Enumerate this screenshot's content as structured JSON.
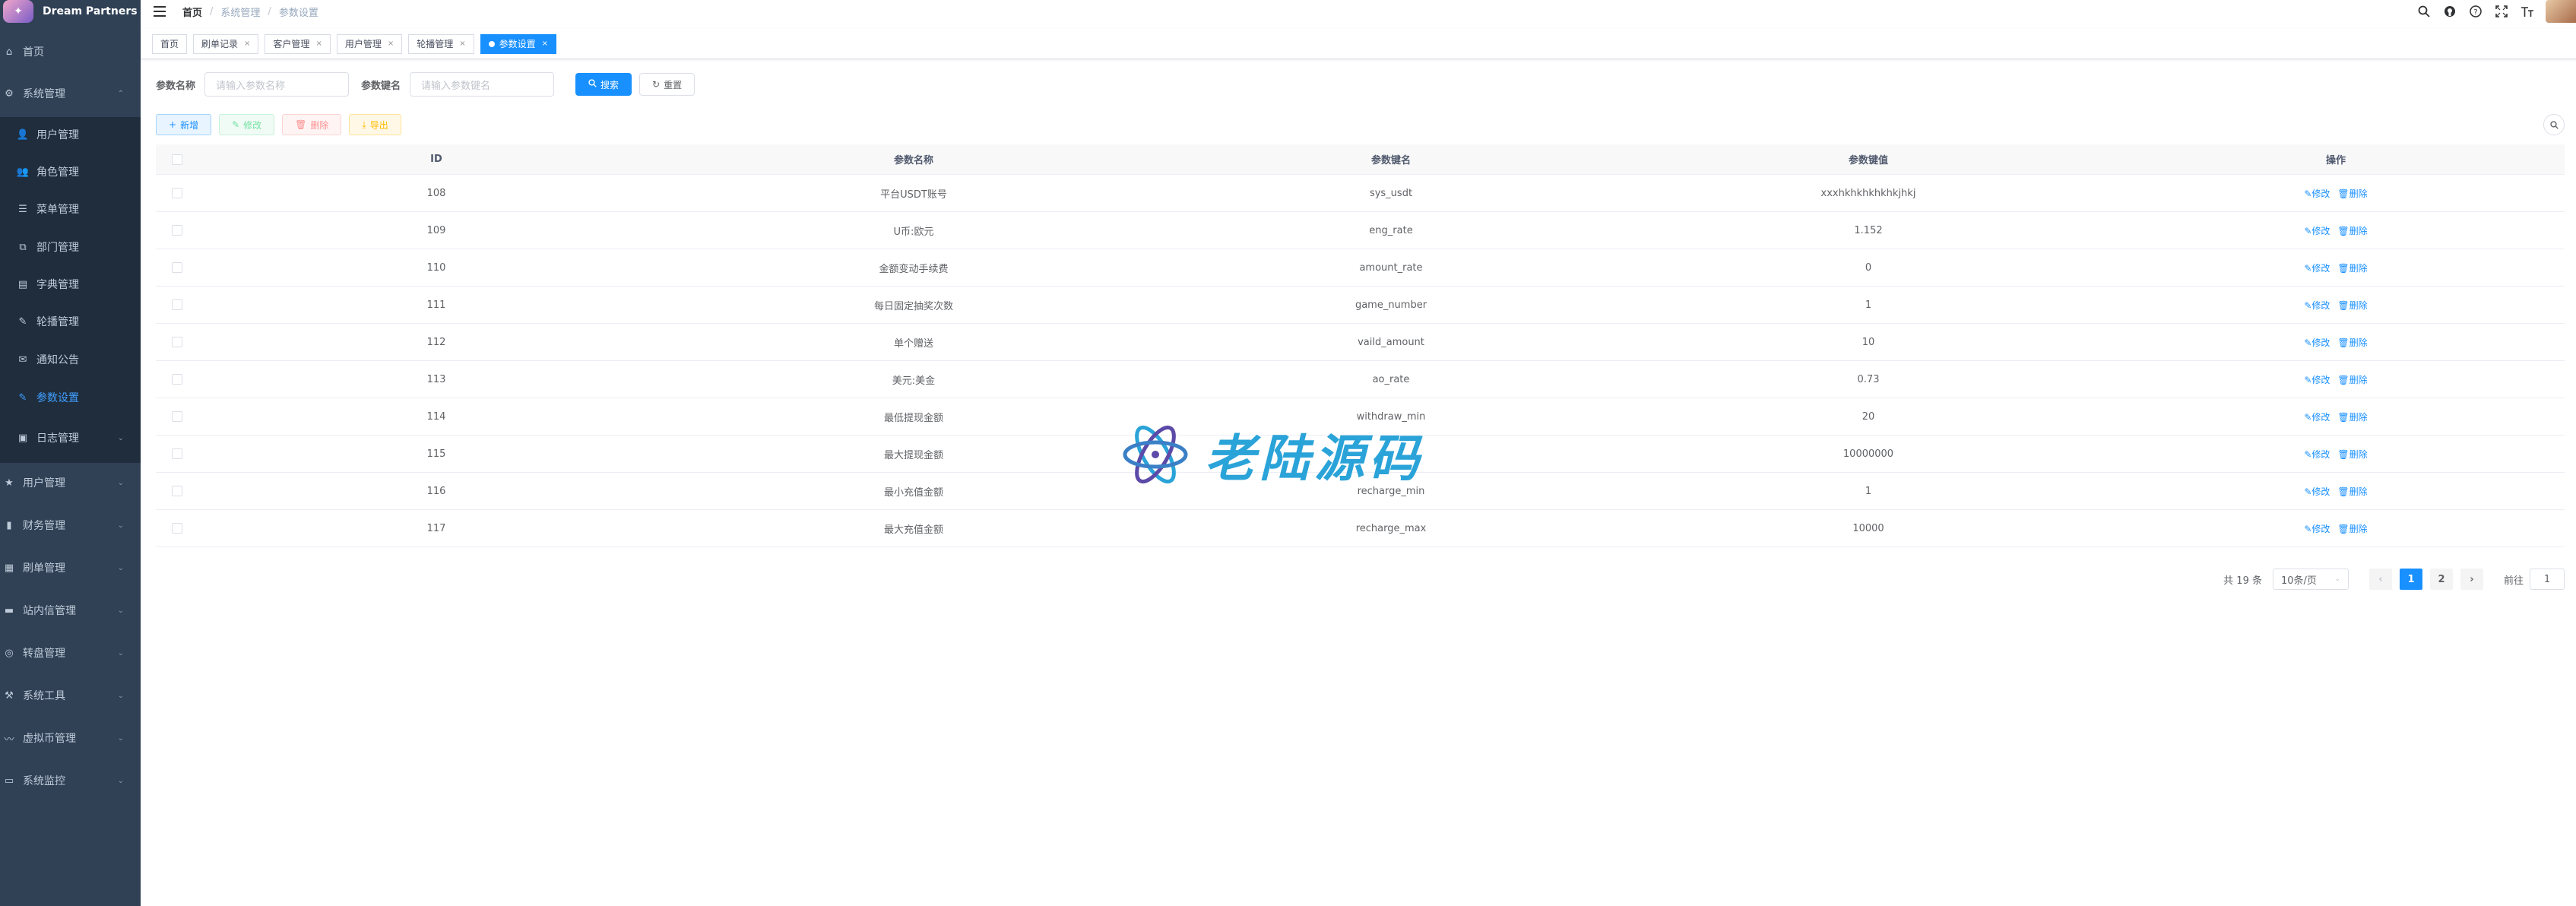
{
  "app": {
    "title": "Dream Partners"
  },
  "sidebar": {
    "items": [
      {
        "label": "首页",
        "icon": "dashboard-icon",
        "type": "top"
      },
      {
        "label": "系统管理",
        "icon": "gear-icon",
        "type": "group-open"
      },
      {
        "label": "用户管理",
        "icon": "user-icon",
        "type": "sub"
      },
      {
        "label": "角色管理",
        "icon": "peoples-icon",
        "type": "sub"
      },
      {
        "label": "菜单管理",
        "icon": "tree-table-icon",
        "type": "sub"
      },
      {
        "label": "部门管理",
        "icon": "tree-icon",
        "type": "sub"
      },
      {
        "label": "字典管理",
        "icon": "dict-icon",
        "type": "sub"
      },
      {
        "label": "轮播管理",
        "icon": "edit-icon",
        "type": "sub"
      },
      {
        "label": "通知公告",
        "icon": "message-icon",
        "type": "sub"
      },
      {
        "label": "参数设置",
        "icon": "edit-icon",
        "type": "sub-active"
      },
      {
        "label": "日志管理",
        "icon": "log-icon",
        "type": "sub-group"
      },
      {
        "label": "用户管理",
        "icon": "star-icon",
        "type": "group"
      },
      {
        "label": "财务管理",
        "icon": "chart-icon",
        "type": "group"
      },
      {
        "label": "刷单管理",
        "icon": "form-icon",
        "type": "group"
      },
      {
        "label": "站内信管理",
        "icon": "folder-icon",
        "type": "group"
      },
      {
        "label": "转盘管理",
        "icon": "cycle-icon",
        "type": "group"
      },
      {
        "label": "系统工具",
        "icon": "tool-icon",
        "type": "group"
      },
      {
        "label": "虚拟币管理",
        "icon": "coin-icon",
        "type": "group"
      },
      {
        "label": "系统监控",
        "icon": "monitor-icon",
        "type": "group"
      }
    ]
  },
  "header": {
    "breadcrumb": [
      "首页",
      "系统管理",
      "参数设置"
    ]
  },
  "tags": [
    {
      "label": "首页",
      "closable": false,
      "active": false
    },
    {
      "label": "刷单记录",
      "closable": true,
      "active": false
    },
    {
      "label": "客户管理",
      "closable": true,
      "active": false
    },
    {
      "label": "用户管理",
      "closable": true,
      "active": false
    },
    {
      "label": "轮播管理",
      "closable": true,
      "active": false
    },
    {
      "label": "参数设置",
      "closable": true,
      "active": true
    }
  ],
  "search": {
    "name_label": "参数名称",
    "name_placeholder": "请输入参数名称",
    "key_label": "参数键名",
    "key_placeholder": "请输入参数键名",
    "search_button": "搜索",
    "reset_button": "重置"
  },
  "toolbar": {
    "add": "新增",
    "edit": "修改",
    "delete": "删除",
    "export": "导出"
  },
  "table": {
    "columns": [
      "ID",
      "参数名称",
      "参数键名",
      "参数键值",
      "操作"
    ],
    "edit_label": "修改",
    "delete_label": "删除",
    "rows": [
      {
        "id": "108",
        "name": "平台USDT账号",
        "key": "sys_usdt",
        "value": "xxxhkhkhkhkhkjhkj"
      },
      {
        "id": "109",
        "name": "U币:欧元",
        "key": "eng_rate",
        "value": "1.152"
      },
      {
        "id": "110",
        "name": "金额变动手续费",
        "key": "amount_rate",
        "value": "0"
      },
      {
        "id": "111",
        "name": "每日固定抽奖次数",
        "key": "game_number",
        "value": "1"
      },
      {
        "id": "112",
        "name": "单个赠送",
        "key": "vaild_amount",
        "value": "10"
      },
      {
        "id": "113",
        "name": "美元:美金",
        "key": "ao_rate",
        "value": "0.73"
      },
      {
        "id": "114",
        "name": "最低提现金额",
        "key": "withdraw_min",
        "value": "20"
      },
      {
        "id": "115",
        "name": "最大提现金额",
        "key": "",
        "value": "10000000"
      },
      {
        "id": "116",
        "name": "最小充值金额",
        "key": "recharge_min",
        "value": "1"
      },
      {
        "id": "117",
        "name": "最大充值金额",
        "key": "recharge_max",
        "value": "10000"
      }
    ]
  },
  "pagination": {
    "total": "共 19 条",
    "page_size": "10条/页",
    "pages": [
      "1",
      "2"
    ],
    "current": "1",
    "goto_label": "前往",
    "goto_value": "1"
  },
  "watermark": {
    "text": "老陆源码"
  },
  "colors": {
    "sidebar": "#304156",
    "submenu": "#1f2d3d",
    "primary": "#1890ff"
  }
}
